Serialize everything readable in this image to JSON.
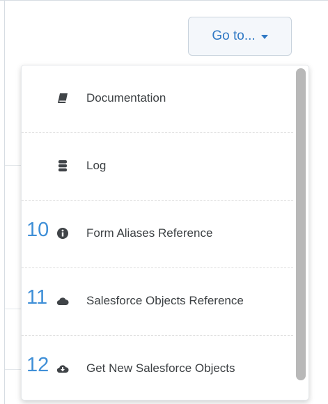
{
  "header": {
    "goto_label": "Go to..."
  },
  "menu": {
    "items": [
      {
        "number": "",
        "icon": "book-icon",
        "label": "Documentation"
      },
      {
        "number": "",
        "icon": "database-icon",
        "label": "Log"
      },
      {
        "number": "10",
        "icon": "info-circle-icon",
        "label": "Form Aliases Reference"
      },
      {
        "number": "11",
        "icon": "cloud-icon",
        "label": "Salesforce Objects Reference"
      },
      {
        "number": "12",
        "icon": "cloud-download-icon",
        "label": "Get New Salesforce Objects"
      }
    ]
  },
  "colors": {
    "accent": "#2f78c4",
    "number": "#3f8fd7",
    "text": "#3c4043",
    "icon": "#404448"
  }
}
